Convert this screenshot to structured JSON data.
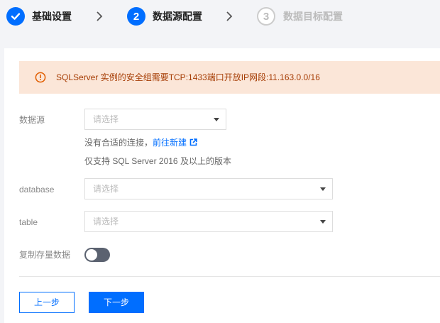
{
  "stepper": {
    "steps": [
      {
        "number": "",
        "label": "基础设置",
        "state": "done"
      },
      {
        "number": "2",
        "label": "数据源配置",
        "state": "active"
      },
      {
        "number": "3",
        "label": "数据目标配置",
        "state": "pending"
      }
    ]
  },
  "alert": {
    "icon": "warning-circle-icon",
    "text": "SQLServer 实例的安全组需要TCP:1433端口开放IP网段:11.163.0.0/16"
  },
  "form": {
    "datasource": {
      "label": "数据源",
      "placeholder": "请选择",
      "hint_prefix": "没有合适的连接，",
      "hint_link": "前往新建",
      "version_note": "仅支持 SQL Server 2016 及以上的版本"
    },
    "database": {
      "label": "database",
      "placeholder": "请选择"
    },
    "table": {
      "label": "table",
      "placeholder": "请选择"
    },
    "copy_stock": {
      "label": "复制存量数据",
      "enabled": false
    }
  },
  "buttons": {
    "prev": "上一步",
    "next": "下一步"
  },
  "colors": {
    "primary": "#006eff",
    "alert_bg": "#fbe6d8",
    "alert_text": "#a63d05"
  }
}
